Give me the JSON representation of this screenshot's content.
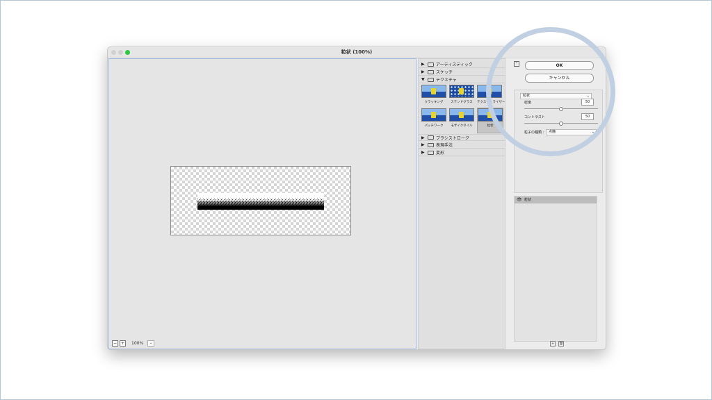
{
  "window": {
    "title": "粒状 (100%)"
  },
  "preview": {
    "zoom_minus": "−",
    "zoom_plus": "+",
    "zoom_level": "100%",
    "zoom_caret": "⌄"
  },
  "gallery": {
    "categories_top": [
      {
        "label": "アーティスティック",
        "expanded": false
      },
      {
        "label": "スケッチ",
        "expanded": false
      },
      {
        "label": "テクスチャ",
        "expanded": true
      }
    ],
    "thumbs": [
      {
        "label": "クラッキング"
      },
      {
        "label": "ステンドグラス"
      },
      {
        "label": "テクスチャライザー"
      },
      {
        "label": "パッチワーク"
      },
      {
        "label": "モザイクタイル"
      },
      {
        "label": "粒状",
        "selected": true
      }
    ],
    "categories_bottom": [
      {
        "label": "ブラシストローク",
        "expanded": false
      },
      {
        "label": "表現手法",
        "expanded": false
      },
      {
        "label": "変形",
        "expanded": false
      }
    ]
  },
  "settings": {
    "ok_label": "OK",
    "cancel_label": "キャンセル",
    "filter_select": "粒状",
    "density_label": "密度",
    "density_value": "50",
    "density_fraction": 0.5,
    "contrast_label": "コントラスト",
    "contrast_value": "50",
    "contrast_fraction": 0.5,
    "grain_type_label": "粒子の種類 :",
    "grain_type_value": "点描"
  },
  "layers": {
    "active_layer": "粒状"
  },
  "colors": {
    "highlight_ring": "#c0d0e2",
    "preview_border": "#9fbbe0",
    "traffic_light_green": "#2ac940"
  }
}
